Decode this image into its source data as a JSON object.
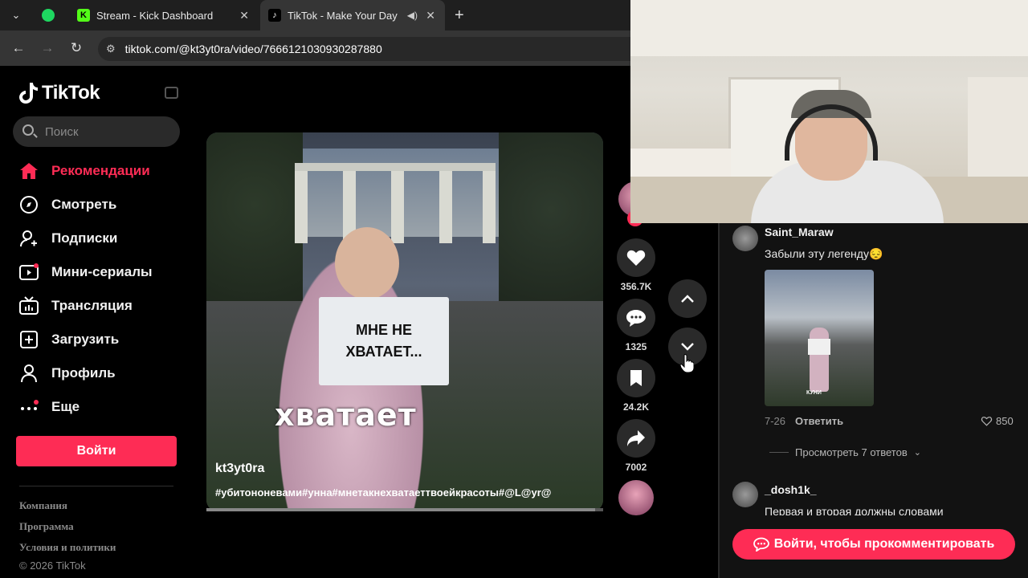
{
  "browser": {
    "tabs": [
      {
        "title": "Stream - Kick Dashboard",
        "icon": "kick-icon"
      },
      {
        "title": "TikTok - Make Your Day",
        "icon": "tiktok-icon"
      }
    ],
    "url": "tiktok.com/@kt3yt0ra/video/7666121030930287880"
  },
  "tiktok": {
    "brand": "TikTok",
    "search_placeholder": "Поиск",
    "nav": [
      {
        "label": "Рекомендации",
        "icon": "home-icon"
      },
      {
        "label": "Смотреть",
        "icon": "compass-icon"
      },
      {
        "label": "Подписки",
        "icon": "following-icon"
      },
      {
        "label": "Мини-сериалы",
        "icon": "series-icon"
      },
      {
        "label": "Трансляция",
        "icon": "live-tv-icon"
      },
      {
        "label": "Загрузить",
        "icon": "upload-icon"
      },
      {
        "label": "Профиль",
        "icon": "profile-icon"
      },
      {
        "label": "Еще",
        "icon": "more-icon"
      }
    ],
    "login_label": "Войти",
    "footer": [
      "Компания",
      "Программа",
      "Условия и политики"
    ],
    "copyright": "© 2026 TikTok"
  },
  "video": {
    "sign_text_line1": "МНЕ НЕ",
    "sign_text_line2": "ХВАТАЕТ...",
    "overlay_word": "хватает",
    "author": "kt3yt0ra",
    "tags": "#убитононевами#унна#мнетакнехватаеттвоейкрасоты#@L@yr@",
    "progress": 0.98
  },
  "actions": {
    "likes": "356.7K",
    "comments": "1325",
    "saves": "24.2K",
    "shares": "7002"
  },
  "comments": [
    {
      "user": "Saint_Maraw",
      "text": "Забыли эту легенду😔",
      "date": "7-26",
      "reply": "Ответить",
      "likes": "850",
      "view_replies": "Просмотреть 7 ответов",
      "image_caption": "КУНИ"
    },
    {
      "user": "_dosh1k_",
      "text": "Первая и вторая должны словами"
    }
  ],
  "comment_login": "Войти, чтобы прокомментировать",
  "colors": {
    "accent": "#fe2c55",
    "background": "#000000"
  }
}
